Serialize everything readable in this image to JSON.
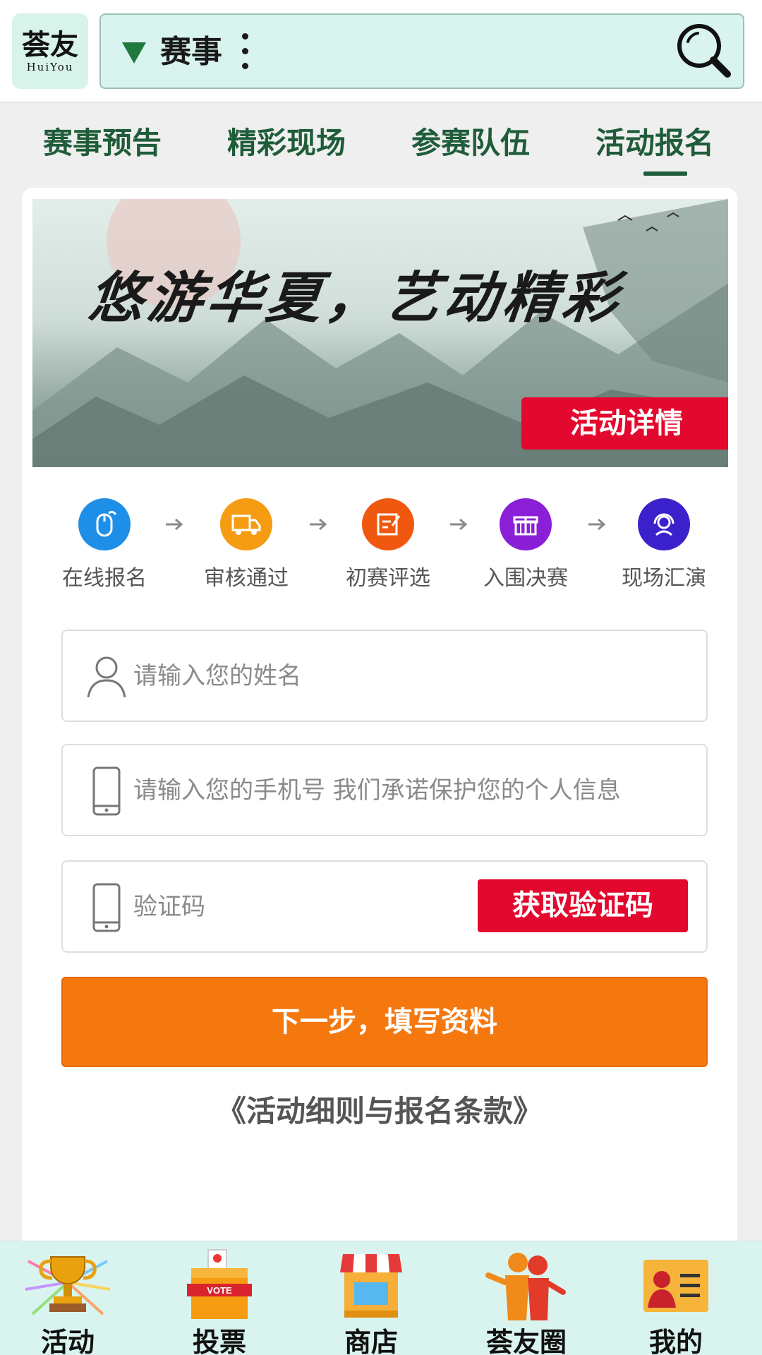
{
  "header": {
    "logo_cn": "荟友",
    "logo_en": "HuiYou",
    "search_category": "赛事"
  },
  "tabs": [
    {
      "label": "赛事预告",
      "active": false
    },
    {
      "label": "精彩现场",
      "active": false
    },
    {
      "label": "参赛队伍",
      "active": false
    },
    {
      "label": "活动报名",
      "active": true
    }
  ],
  "banner": {
    "title": "悠游华夏，艺动精彩",
    "button_label": "活动详情"
  },
  "steps": [
    {
      "label": "在线报名",
      "icon": "mouse-icon",
      "color": "#1e8fe8"
    },
    {
      "label": "审核通过",
      "icon": "truck-icon",
      "color": "#f59c12"
    },
    {
      "label": "初赛评选",
      "icon": "edit-icon",
      "color": "#f1580f"
    },
    {
      "label": "入围决赛",
      "icon": "gift-icon",
      "color": "#8b1fd8"
    },
    {
      "label": "现场汇演",
      "icon": "headset-icon",
      "color": "#3a21cc"
    }
  ],
  "form": {
    "name_placeholder": "请输入您的姓名",
    "phone_placeholder": "请输入您的手机号 我们承诺保护您的个人信息",
    "code_placeholder": "验证码",
    "get_code_label": "获取验证码",
    "next_label": "下一步，填写资料",
    "terms_label": "《活动细则与报名条款》"
  },
  "bottom_nav": [
    {
      "label": "活动",
      "icon": "trophy-icon"
    },
    {
      "label": "投票",
      "icon": "ballot-box-icon"
    },
    {
      "label": "商店",
      "icon": "store-icon"
    },
    {
      "label": "荟友圈",
      "icon": "friends-icon"
    },
    {
      "label": "我的",
      "icon": "profile-card-icon"
    }
  ],
  "colors": {
    "brand_green": "#1f5c3a",
    "accent_red": "#e3082d",
    "accent_orange": "#f5780f",
    "nav_bg": "#d9f4ee"
  }
}
